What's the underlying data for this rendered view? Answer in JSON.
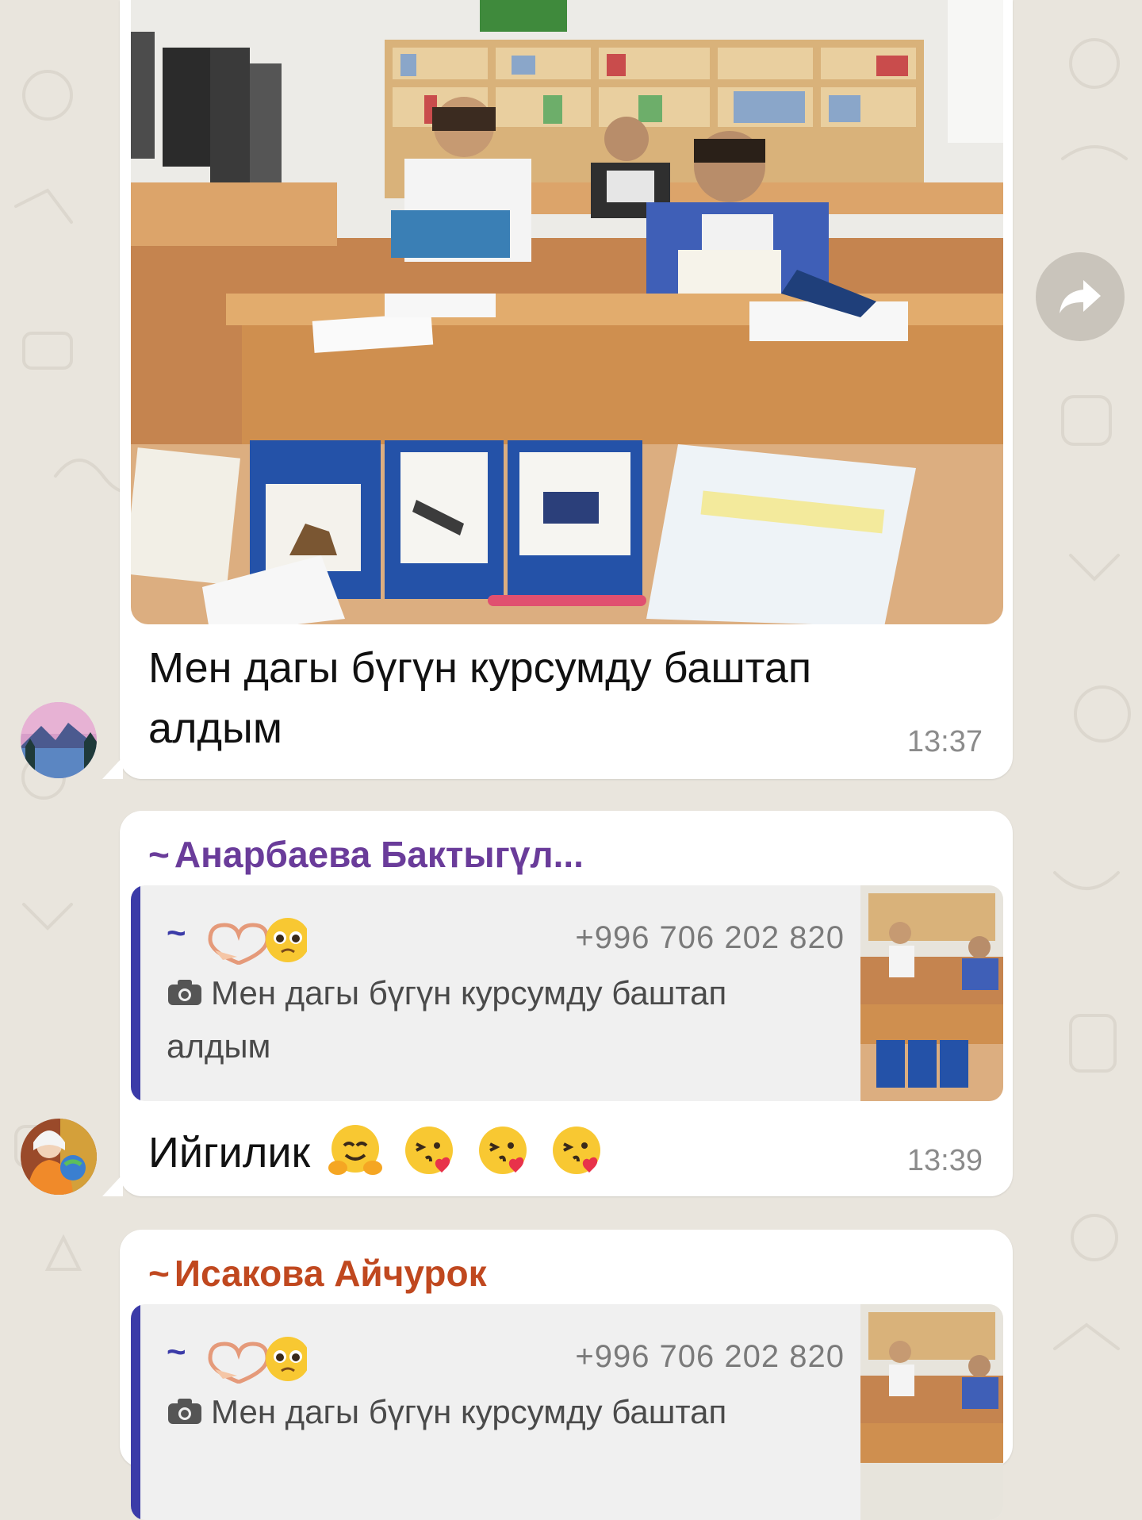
{
  "messages": [
    {
      "type": "photo",
      "caption": "Мен дагы бүгүн курсумду баштап алдым",
      "time": "13:37",
      "avatar": "lake-mountain-avatar"
    },
    {
      "type": "reply",
      "sender": "Анарбаева Бактыгүл...",
      "sender_color": "#6a3c9a",
      "quote": {
        "name": "~",
        "phone": "+996 706 202 820",
        "text": "Мен дагы бүгүн курсумду баштап алдым",
        "icon": "camera-icon"
      },
      "text": "Ийгилик",
      "time": "13:39",
      "avatar": "woman-globe-avatar"
    },
    {
      "type": "reply",
      "sender": "Исакова Айчурок",
      "sender_color": "#c0481f",
      "quote": {
        "name": "~",
        "phone": "+996 706 202 820",
        "text": "Мен дагы бүгүн курсумду баштап",
        "icon": "camera-icon"
      }
    }
  ],
  "tilde": "~",
  "colors": {
    "quote_bar": "#3b3ba8",
    "wallpaper": "#e9e5dd"
  }
}
